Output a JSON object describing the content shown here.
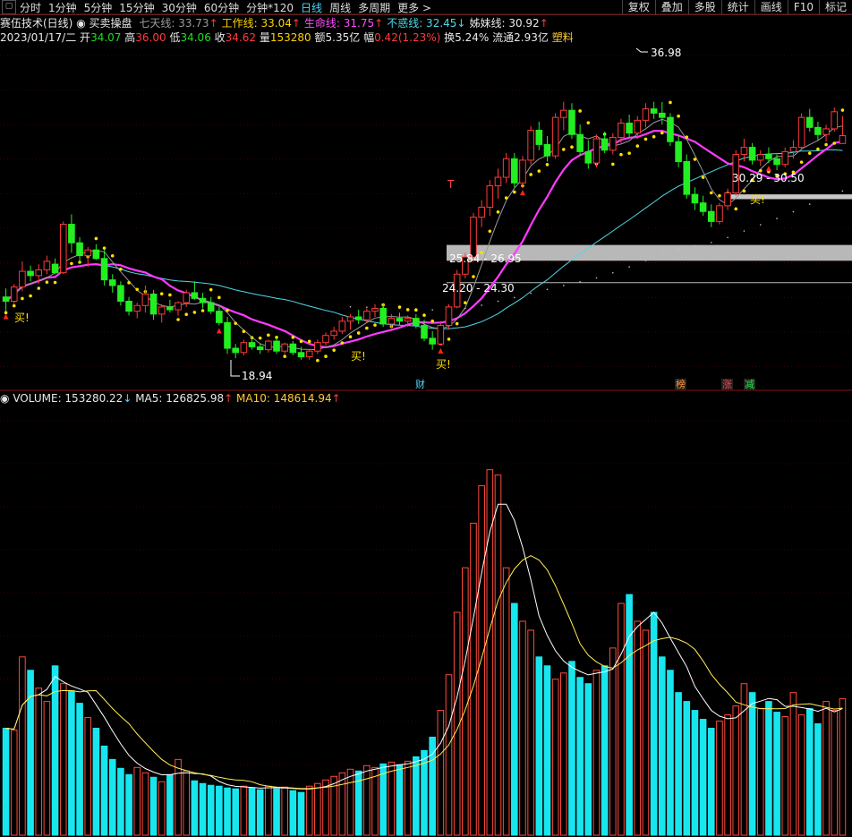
{
  "toolbar": {
    "timeframes": [
      "分时",
      "1分钟",
      "5分钟",
      "15分钟",
      "30分钟",
      "60分钟",
      "分钟*120",
      "日线",
      "周线",
      "多周期",
      "更多 >"
    ],
    "active": "日线",
    "right_buttons": [
      "复权",
      "叠加",
      "多股",
      "统计",
      "画线",
      "F10",
      "标记"
    ]
  },
  "indicator": {
    "stock_title": "赛伍技术(日线)",
    "formula_name": "买卖操盘",
    "lines": [
      {
        "label": "七天线: 33.73",
        "arrow": "↑",
        "color": "#9a9a9a"
      },
      {
        "label": "工作线: 33.04",
        "arrow": "↑",
        "color": "#ffd200"
      },
      {
        "label": "生命线: 31.75",
        "arrow": "↑",
        "color": "#ff4fff"
      },
      {
        "label": "不惑线: 32.45",
        "arrow": "↓",
        "color": "#4fd8e8"
      },
      {
        "label": "姊妹线: 30.92",
        "arrow": "↑",
        "color": "#e8e8e8"
      }
    ]
  },
  "info": {
    "date": "2023/01/17/二",
    "open_label": "开",
    "open": "34.07",
    "high_label": "高",
    "high": "36.00",
    "low_label": "低",
    "low": "34.06",
    "close_label": "收",
    "close": "34.62",
    "vol_label": "量",
    "vol": "153280",
    "amount_label": "额",
    "amount": "5.35亿",
    "change_label": "幅",
    "change": "0.42(1.23%)",
    "turnover_label": "换",
    "turnover": "5.24%",
    "float_label": "流通",
    "float": "2.93亿",
    "sector": "塑料"
  },
  "annotations": {
    "high_price": "36.98",
    "low_price": "18.94",
    "zone_upper": "25.84 - 26.95",
    "zone_lower": "24.20 - 24.30",
    "zone_right": "30.29 - 30.50",
    "buy": "买!",
    "t_marker": "T"
  },
  "badges": [
    "财",
    "榜",
    "涨",
    "减"
  ],
  "volume": {
    "label": "VOLUME: 153280.22",
    "label_arrow": "↓",
    "ma5": "MA5: 126825.98",
    "ma5_arrow": "↑",
    "ma10": "MA10: 148614.94",
    "ma10_arrow": "↑"
  },
  "chart_data": {
    "type": "candlestick",
    "price_ylim": [
      17,
      41
    ],
    "candles": [
      [
        23.3,
        23.9,
        22.3,
        23.0
      ],
      [
        23.0,
        24.2,
        22.8,
        24.0
      ],
      [
        24.0,
        25.8,
        23.7,
        25.1
      ],
      [
        25.1,
        25.5,
        24.4,
        24.8
      ],
      [
        24.8,
        25.6,
        24.2,
        25.2
      ],
      [
        25.2,
        26.2,
        24.9,
        25.8
      ],
      [
        25.6,
        26.0,
        24.9,
        25.0
      ],
      [
        25.0,
        28.6,
        24.9,
        28.4
      ],
      [
        28.4,
        29.1,
        26.4,
        27.1
      ],
      [
        27.1,
        27.5,
        25.7,
        26.2
      ],
      [
        26.2,
        26.8,
        25.4,
        26.6
      ],
      [
        26.6,
        27.0,
        25.9,
        26.0
      ],
      [
        26.0,
        26.6,
        24.1,
        24.5
      ],
      [
        24.5,
        24.9,
        23.6,
        24.1
      ],
      [
        24.1,
        24.4,
        22.7,
        23.0
      ],
      [
        23.0,
        23.3,
        22.0,
        22.3
      ],
      [
        22.3,
        22.9,
        21.8,
        22.7
      ],
      [
        22.7,
        24.1,
        22.2,
        23.5
      ],
      [
        23.5,
        23.8,
        21.7,
        22.1
      ],
      [
        22.1,
        22.8,
        21.5,
        22.6
      ],
      [
        22.6,
        23.1,
        22.2,
        22.4
      ],
      [
        22.4,
        23.0,
        22.0,
        22.9
      ],
      [
        22.9,
        23.8,
        22.6,
        23.6
      ],
      [
        23.6,
        24.4,
        23.1,
        23.2
      ],
      [
        23.2,
        23.6,
        22.5,
        22.9
      ],
      [
        22.9,
        23.3,
        22.1,
        22.3
      ],
      [
        22.3,
        22.6,
        21.3,
        21.5
      ],
      [
        21.5,
        21.9,
        19.3,
        19.7
      ],
      [
        19.7,
        20.0,
        19.0,
        19.4
      ],
      [
        19.4,
        20.3,
        19.2,
        20.1
      ],
      [
        20.1,
        20.5,
        19.6,
        19.8
      ],
      [
        19.8,
        20.0,
        19.3,
        19.6
      ],
      [
        19.6,
        20.3,
        19.4,
        20.2
      ],
      [
        20.2,
        20.4,
        19.3,
        19.5
      ],
      [
        19.5,
        20.1,
        19.3,
        20.0
      ],
      [
        20.0,
        20.2,
        19.2,
        19.4
      ],
      [
        19.4,
        19.8,
        18.9,
        19.1
      ],
      [
        19.1,
        19.6,
        18.9,
        19.5
      ],
      [
        19.5,
        20.3,
        19.3,
        20.1
      ],
      [
        20.1,
        20.8,
        19.9,
        20.6
      ],
      [
        20.6,
        21.2,
        20.3,
        20.9
      ],
      [
        20.9,
        21.9,
        20.7,
        21.6
      ],
      [
        21.6,
        22.1,
        21.0,
        21.9
      ],
      [
        21.9,
        22.4,
        21.4,
        21.7
      ],
      [
        21.7,
        22.5,
        21.5,
        22.3
      ],
      [
        22.3,
        22.8,
        21.9,
        22.5
      ],
      [
        22.5,
        22.8,
        21.2,
        21.4
      ],
      [
        21.4,
        22.1,
        21.1,
        21.8
      ],
      [
        21.8,
        22.2,
        21.3,
        21.6
      ],
      [
        21.6,
        22.0,
        21.2,
        21.8
      ],
      [
        21.8,
        22.1,
        21.1,
        21.3
      ],
      [
        21.3,
        21.7,
        20.2,
        20.4
      ],
      [
        20.4,
        20.9,
        19.6,
        20.0
      ],
      [
        20.0,
        21.5,
        19.9,
        21.3
      ],
      [
        21.3,
        22.8,
        21.0,
        22.6
      ],
      [
        22.6,
        25.2,
        22.5,
        24.9
      ],
      [
        24.9,
        26.4,
        24.6,
        26.1
      ],
      [
        26.1,
        29.2,
        25.8,
        28.9
      ],
      [
        28.9,
        30.1,
        28.2,
        29.6
      ],
      [
        29.6,
        31.5,
        29.0,
        31.1
      ],
      [
        31.1,
        32.3,
        30.2,
        31.7
      ],
      [
        31.7,
        33.4,
        31.3,
        33.0
      ],
      [
        33.0,
        33.4,
        31.0,
        31.3
      ],
      [
        31.3,
        33.2,
        31.0,
        32.9
      ],
      [
        32.9,
        35.3,
        32.6,
        35.0
      ],
      [
        35.0,
        35.6,
        33.6,
        34.0
      ],
      [
        34.0,
        34.6,
        32.8,
        33.2
      ],
      [
        33.2,
        36.2,
        33.0,
        35.9
      ],
      [
        35.9,
        37.0,
        35.0,
        36.4
      ],
      [
        36.4,
        36.9,
        34.4,
        34.7
      ],
      [
        34.7,
        35.4,
        33.2,
        33.5
      ],
      [
        33.5,
        34.3,
        32.3,
        32.7
      ],
      [
        32.7,
        34.7,
        32.4,
        34.4
      ],
      [
        34.4,
        34.9,
        33.4,
        33.6
      ],
      [
        33.6,
        34.8,
        33.3,
        34.5
      ],
      [
        34.5,
        35.8,
        34.1,
        35.5
      ],
      [
        35.5,
        36.1,
        34.5,
        34.8
      ],
      [
        34.8,
        36.0,
        34.4,
        35.7
      ],
      [
        35.7,
        36.9,
        35.2,
        36.5
      ],
      [
        36.5,
        37.0,
        35.8,
        36.2
      ],
      [
        36.2,
        36.98,
        35.4,
        35.9
      ],
      [
        35.9,
        36.2,
        33.9,
        34.2
      ],
      [
        34.2,
        34.6,
        32.4,
        32.8
      ],
      [
        32.8,
        33.3,
        30.2,
        30.5
      ],
      [
        30.5,
        31.0,
        29.4,
        29.9
      ],
      [
        29.9,
        30.4,
        29.0,
        29.3
      ],
      [
        29.3,
        29.8,
        28.2,
        28.6
      ],
      [
        28.6,
        29.9,
        28.4,
        29.7
      ],
      [
        29.7,
        30.9,
        29.4,
        30.6
      ],
      [
        30.6,
        33.6,
        30.4,
        33.3
      ],
      [
        33.3,
        34.4,
        32.8,
        33.8
      ],
      [
        33.8,
        34.1,
        32.6,
        32.9
      ],
      [
        32.9,
        33.6,
        32.5,
        33.3
      ],
      [
        33.3,
        33.8,
        32.7,
        33.0
      ],
      [
        33.0,
        33.3,
        32.2,
        32.6
      ],
      [
        32.6,
        33.8,
        32.4,
        33.5
      ],
      [
        33.5,
        34.3,
        33.0,
        33.8
      ],
      [
        33.8,
        36.2,
        33.6,
        35.9
      ],
      [
        35.9,
        36.5,
        34.9,
        35.2
      ],
      [
        35.2,
        35.6,
        34.3,
        34.7
      ],
      [
        34.7,
        35.4,
        34.2,
        35.1
      ],
      [
        35.1,
        36.6,
        34.9,
        36.3
      ],
      [
        34.07,
        36.0,
        34.06,
        34.62
      ]
    ],
    "volume_ylim": [
      0,
      480000
    ],
    "volumes": [
      120000,
      118000,
      200000,
      185000,
      165000,
      150000,
      190000,
      170000,
      162000,
      148000,
      132000,
      120000,
      100000,
      85000,
      75000,
      68000,
      76000,
      70000,
      65000,
      60000,
      68000,
      85000,
      72000,
      61000,
      58000,
      56000,
      55000,
      53000,
      52000,
      55000,
      53000,
      51000,
      55000,
      52000,
      54000,
      50000,
      48000,
      55000,
      58000,
      62000,
      66000,
      70000,
      74000,
      72000,
      78000,
      76000,
      80000,
      82000,
      79000,
      83000,
      88000,
      95000,
      110000,
      140000,
      180000,
      250000,
      300000,
      350000,
      392000,
      410000,
      404000,
      300000,
      260000,
      240000,
      230000,
      200000,
      190000,
      175000,
      182000,
      195000,
      177000,
      170000,
      185000,
      190000,
      210000,
      260000,
      270000,
      240000,
      230000,
      250000,
      200000,
      185000,
      160000,
      150000,
      140000,
      130000,
      120000,
      128000,
      135000,
      145000,
      170000,
      160000,
      142000,
      150000,
      138000,
      133000,
      160000,
      135000,
      142000,
      125000,
      150000,
      140000,
      153280
    ]
  }
}
